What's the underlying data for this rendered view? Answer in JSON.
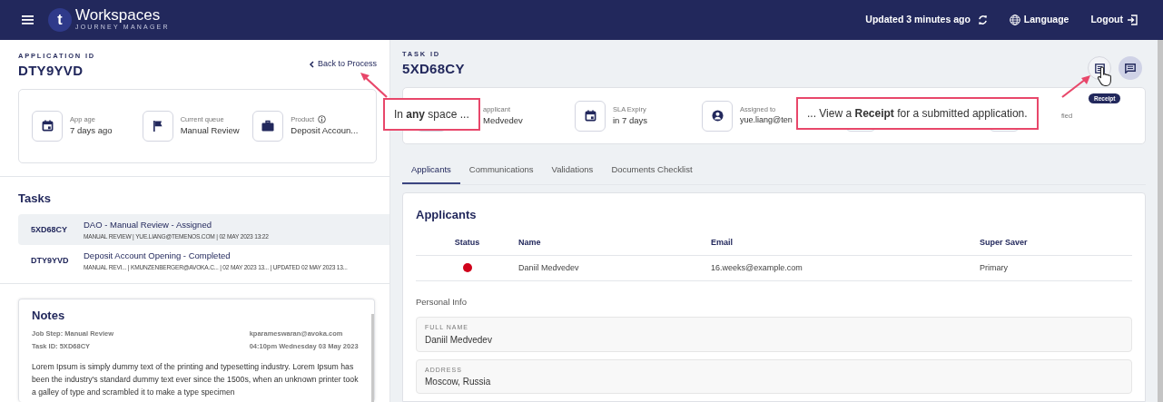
{
  "header": {
    "logo_letter": "t",
    "brand": "Workspaces",
    "subtitle": "JOURNEY MANAGER",
    "updated": "Updated 3 minutes ago",
    "language": "Language",
    "logout": "Logout"
  },
  "application": {
    "label": "APPLICATION ID",
    "id": "DTY9YVD",
    "back": "Back to Process",
    "summary": [
      {
        "kind": "calendar",
        "label": "App age",
        "value": "7 days ago",
        "info": false
      },
      {
        "kind": "flag",
        "label": "Current queue",
        "value": "Manual Review",
        "info": false
      },
      {
        "kind": "briefcase",
        "label": "Product",
        "value": "Deposit Accoun...",
        "info": true
      }
    ]
  },
  "tasks": {
    "title": "Tasks",
    "items": [
      {
        "id": "5XD68CY",
        "title": "DAO - Manual Review - Assigned",
        "meta": "MANUAL REVIEW | YUE.LIANG@TEMENOS.COM | 02 MAY 2023 13:22",
        "selected": true
      },
      {
        "id": "DTY9YVD",
        "title": "Deposit Account Opening - Completed",
        "meta": "MANUAL REVI... | KMUNZENBERGER@AVOKA.C... | 02 MAY 2023 13... | UPDATED 02 MAY 2023 13...",
        "selected": false
      }
    ]
  },
  "notes": {
    "title": "Notes",
    "job_step": "Job Step: Manual Review",
    "task_id": "Task ID: 5XD68CY",
    "author": "kparameswaran@avoka.com",
    "time": "04:10pm Wednesday 03 May 2023",
    "body": "Lorem Ipsum is simply dummy text of the printing and typesetting industry. Lorem Ipsum has been the industry's standard dummy text ever since the 1500s, when an unknown printer took a galley of type and scrambled it to make a type specimen"
  },
  "task": {
    "label": "TASK ID",
    "id": "5XD68CY",
    "tooltip": "Receipt",
    "summary": [
      {
        "kind": "hidden",
        "label": "applicant",
        "value": "Medvedev"
      },
      {
        "kind": "calendar",
        "label": "SLA Expiry",
        "value": "in 7 days"
      },
      {
        "kind": "person",
        "label": "Assigned to",
        "value": "yue.liang@ten"
      },
      {
        "kind": "hidden"
      },
      {
        "kind": "hidden",
        "label": "fied"
      }
    ]
  },
  "tabs": [
    {
      "label": "Applicants",
      "selected": true
    },
    {
      "label": "Communications",
      "selected": false
    },
    {
      "label": "Validations",
      "selected": false
    },
    {
      "label": "Documents Checklist",
      "selected": false
    }
  ],
  "applicants": {
    "title": "Applicants",
    "columns": [
      "Status",
      "Name",
      "Email",
      "Super Saver"
    ],
    "rows": [
      {
        "color": "#d0021b",
        "name": "Daniil Medvedev",
        "email": "16.weeks@example.com",
        "super_saver": "Primary"
      }
    ]
  },
  "personal_info": {
    "title": "Personal Info",
    "fields": [
      {
        "label": "FULL NAME",
        "value": "Daniil Medvedev"
      },
      {
        "label": "ADDRESS",
        "value": "Moscow, Russia"
      }
    ]
  },
  "callouts": [
    {
      "text": "In **any** space ..."
    },
    {
      "text": "... View a **Receipt** for a submitted application."
    }
  ]
}
